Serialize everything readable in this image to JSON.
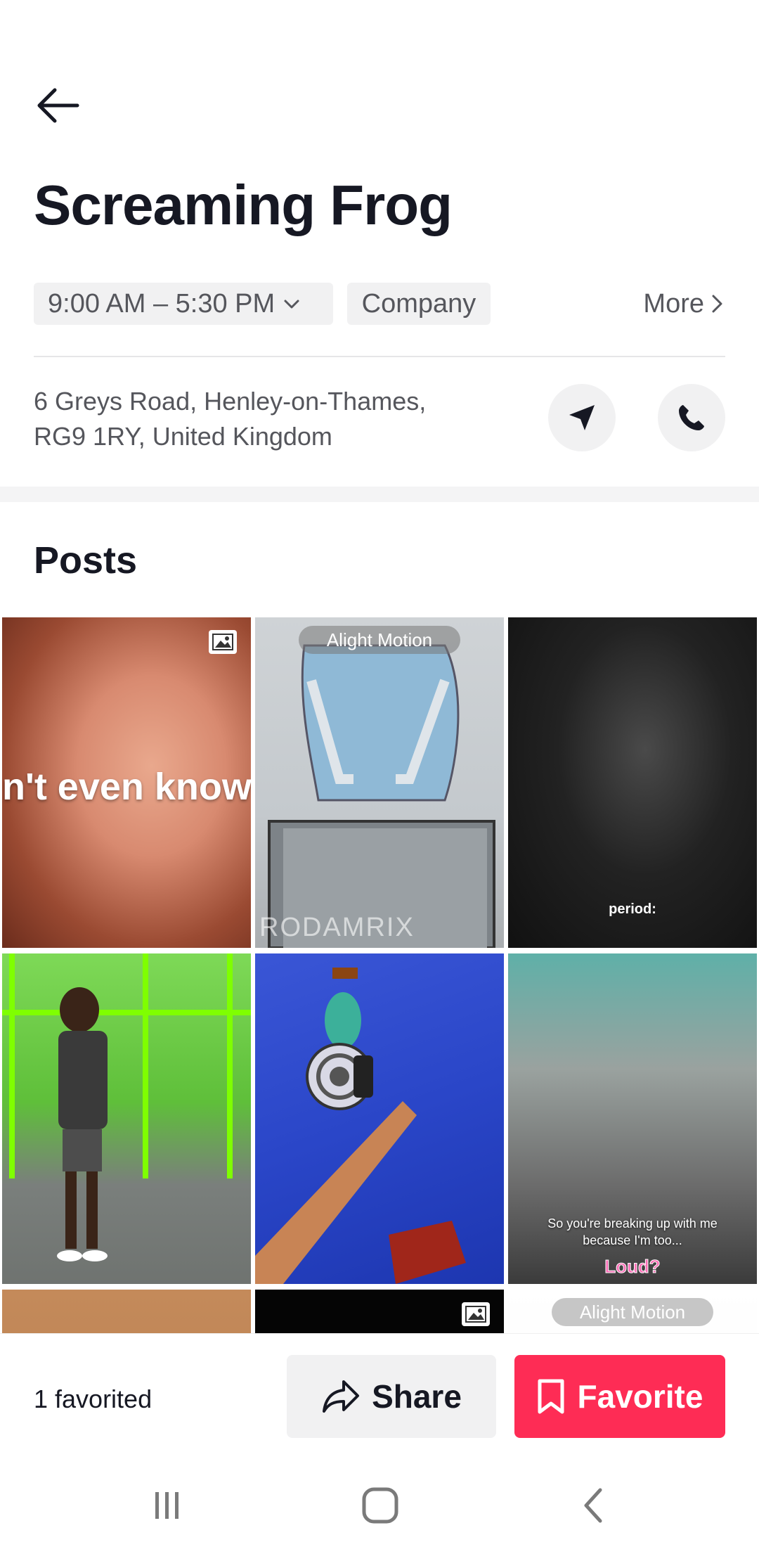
{
  "header": {
    "back_icon": "arrow-left-icon",
    "title": "Screaming Frog"
  },
  "info": {
    "hours": "9:00 AM – 5:30 PM",
    "category": "Company",
    "more_label": "More",
    "address_line1": "6 Greys Road, Henley-on-Thames,",
    "address_line2": "RG9 1RY, United Kingdom",
    "navigate_icon": "navigation-arrow-icon",
    "call_icon": "phone-icon"
  },
  "posts": {
    "title": "Posts",
    "items": [
      {
        "caption": "n't even know",
        "badge": "photo-icon"
      },
      {
        "watermark": "Alight Motion",
        "bottom_text": "RODAMRIX"
      },
      {
        "caption": "period:"
      },
      {
        "caption": ""
      },
      {
        "caption": ""
      },
      {
        "caption": "So you're breaking up with me because I'm too...",
        "caption2": "Loud?"
      },
      {
        "caption": ""
      },
      {
        "badge": "photo-icon"
      },
      {
        "watermark": "Alight Motion"
      }
    ]
  },
  "actions": {
    "favorited_count": "1 favorited",
    "share_label": "Share",
    "favorite_label": "Favorite",
    "accent_color": "#fe2c55"
  },
  "system_nav": {
    "recent_icon": "recent-apps-icon",
    "home_icon": "home-icon",
    "back_icon": "back-chevron-icon"
  }
}
